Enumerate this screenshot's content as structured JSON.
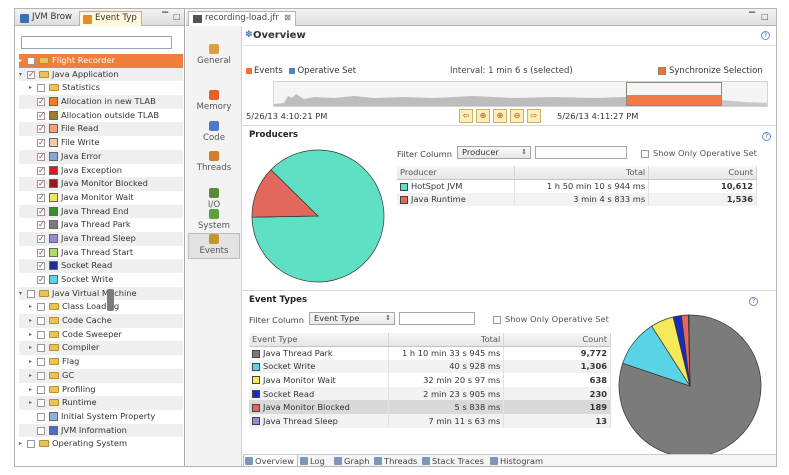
{
  "left_panel": {
    "tabs": [
      {
        "label": "JVM Brow",
        "icon": "jvm-browser-icon"
      },
      {
        "label": "Event Typ",
        "icon": "event-types-icon"
      }
    ],
    "filter_placeholder": "",
    "tree": [
      {
        "label": "Flight Recorder",
        "level": 0,
        "twist": "▸",
        "selected": true,
        "type": "folder"
      },
      {
        "label": "Java Application",
        "level": 0,
        "twist": "▾",
        "type": "folder",
        "checked": true
      },
      {
        "label": "Statistics",
        "level": 1,
        "twist": "▸",
        "type": "folder"
      },
      {
        "label": "Allocation in new TLAB",
        "level": 1,
        "type": "event",
        "color": "#ff7a1a",
        "checked": true
      },
      {
        "label": "Allocation outside TLAB",
        "level": 1,
        "type": "event",
        "color": "#a07b30",
        "checked": true
      },
      {
        "label": "File Read",
        "level": 1,
        "type": "event",
        "color": "#f3a27a",
        "checked": true
      },
      {
        "label": "File Write",
        "level": 1,
        "type": "event",
        "color": "#f4c9aa",
        "checked": true
      },
      {
        "label": "Java Error",
        "level": 1,
        "type": "event",
        "color": "#8aa6d8",
        "checked": true
      },
      {
        "label": "Java Exception",
        "level": 1,
        "type": "event",
        "color": "#d41c2a",
        "checked": true
      },
      {
        "label": "Java Monitor Blocked",
        "level": 1,
        "type": "event",
        "color": "#9b1b1b",
        "checked": true
      },
      {
        "label": "Java Monitor Wait",
        "level": 1,
        "type": "event",
        "color": "#ece95a",
        "checked": true
      },
      {
        "label": "Java Thread End",
        "level": 1,
        "type": "event",
        "color": "#3c8d2b",
        "checked": true
      },
      {
        "label": "Java Thread Park",
        "level": 1,
        "type": "event",
        "color": "#7b7b7b",
        "checked": true
      },
      {
        "label": "Java Thread Sleep",
        "level": 1,
        "type": "event",
        "color": "#9b87d8",
        "checked": true
      },
      {
        "label": "Java Thread Start",
        "level": 1,
        "type": "event",
        "color": "#b0de6a",
        "checked": true
      },
      {
        "label": "Socket Read",
        "level": 1,
        "type": "event",
        "color": "#1a2c9e",
        "checked": true
      },
      {
        "label": "Socket Write",
        "level": 1,
        "type": "event",
        "color": "#5bd3e6",
        "checked": true
      },
      {
        "label": "Java Virtual Machine",
        "level": 0,
        "twist": "▾",
        "type": "folder"
      },
      {
        "label": "Class Loading",
        "level": 1,
        "twist": "▸",
        "type": "folder"
      },
      {
        "label": "Code Cache",
        "level": 1,
        "twist": "▸",
        "type": "folder"
      },
      {
        "label": "Code Sweeper",
        "level": 1,
        "twist": "▸",
        "type": "folder"
      },
      {
        "label": "Compiler",
        "level": 1,
        "twist": "▸",
        "type": "folder"
      },
      {
        "label": "Flag",
        "level": 1,
        "twist": "▸",
        "type": "folder"
      },
      {
        "label": "GC",
        "level": 1,
        "twist": "▸",
        "type": "folder"
      },
      {
        "label": "Profiling",
        "level": 1,
        "twist": "▸",
        "type": "folder"
      },
      {
        "label": "Runtime",
        "level": 1,
        "twist": "▸",
        "type": "folder"
      },
      {
        "label": "Initial System Property",
        "level": 1,
        "type": "event",
        "color": "#8fb0e0"
      },
      {
        "label": "JVM Information",
        "level": 1,
        "type": "event",
        "color": "#4a6fc2"
      },
      {
        "label": "Operating System",
        "level": 0,
        "twist": "▸",
        "type": "folder"
      }
    ]
  },
  "editor": {
    "tab_title": "recording-load.jfr",
    "tab_close": "⊠",
    "sidebar": [
      {
        "label": "General",
        "icon": "general-icon",
        "color": "#d8a040"
      },
      {
        "label": "Memory",
        "icon": "memory-icon",
        "color": "#e6602b"
      },
      {
        "label": "Code",
        "icon": "code-icon",
        "color": "#4f7bc6"
      },
      {
        "label": "Threads",
        "icon": "threads-icon",
        "color": "#d17f2b"
      },
      {
        "label": "I/O",
        "icon": "io-icon",
        "color": "#5a8a3c"
      },
      {
        "label": "System",
        "icon": "system-icon",
        "color": "#59a33f"
      },
      {
        "label": "Events",
        "icon": "events-icon",
        "color": "#c19530",
        "active": true
      }
    ],
    "overview": {
      "title": "Overview",
      "legend": [
        {
          "label": "Events",
          "color": "#f1712b"
        },
        {
          "label": "Operative Set",
          "color": "#4e83c5"
        }
      ],
      "interval": "Interval: 1 min 6 s (selected)",
      "synchronize_label": "Synchronize Selection",
      "start_time": "5/26/13 4:10:21 PM",
      "end_time": "5/26/13 4:11:27 PM",
      "nav_buttons": [
        "⇦",
        "⊕",
        "⊕",
        "⊖",
        "⇨"
      ]
    },
    "producers": {
      "heading": "Producers",
      "filter_label": "Filter Column",
      "filter_value": "Producer",
      "operative_label": "Show Only Operative Set",
      "columns": [
        "Producer",
        "Total",
        "Count"
      ],
      "rows": [
        {
          "name": "HotSpot JVM",
          "color": "#5fe0c4",
          "total": "1 h 50 min 10 s 944 ms",
          "count": "10,612"
        },
        {
          "name": "Java Runtime",
          "color": "#e2675c",
          "total": "3 min 4 s 833 ms",
          "count": "1,536"
        }
      ]
    },
    "event_types": {
      "heading": "Event Types",
      "filter_label": "Filter Column",
      "filter_value": "Event Type",
      "operative_label": "Show Only Operative Set",
      "columns": [
        "Event Type",
        "Total",
        "Count"
      ],
      "rows": [
        {
          "name": "Java Thread Park",
          "color": "#7b7b7b",
          "total": "1 h 10 min 33 s 945 ms",
          "count": "9,772"
        },
        {
          "name": "Socket Write",
          "color": "#5bd3e6",
          "total": "40 s 928 ms",
          "count": "1,306"
        },
        {
          "name": "Java Monitor Wait",
          "color": "#f5e95a",
          "total": "32 min 20 s 97 ms",
          "count": "638"
        },
        {
          "name": "Socket Read",
          "color": "#1a2cc0",
          "total": "2 min 23 s 905 ms",
          "count": "230"
        },
        {
          "name": "Java Monitor Blocked",
          "color": "#e2675c",
          "total": "5 s 838 ms",
          "count": "189"
        },
        {
          "name": "Java Thread Sleep",
          "color": "#9b87d8",
          "total": "7 min 11 s 63 ms",
          "count": "13"
        }
      ]
    },
    "bottom_tabs": [
      {
        "label": "Overview",
        "active": true
      },
      {
        "label": "Log"
      },
      {
        "label": "Graph"
      },
      {
        "label": "Threads"
      },
      {
        "label": "Stack Traces"
      },
      {
        "label": "Histogram"
      }
    ]
  },
  "chart_data": [
    {
      "type": "pie",
      "categories": [
        "HotSpot JVM",
        "Java Runtime"
      ],
      "values": [
        10612,
        1536
      ],
      "colors": [
        "#5fe0c4",
        "#e2675c"
      ]
    },
    {
      "type": "pie",
      "categories": [
        "Java Thread Park",
        "Socket Write",
        "Java Monitor Wait",
        "Socket Read",
        "Java Monitor Blocked",
        "Java Thread Sleep"
      ],
      "values": [
        9772,
        1306,
        638,
        230,
        189,
        13
      ],
      "colors": [
        "#7b7b7b",
        "#5bd3e6",
        "#f5e95a",
        "#1a2cc0",
        "#e2675c",
        "#9b87d8"
      ]
    }
  ]
}
